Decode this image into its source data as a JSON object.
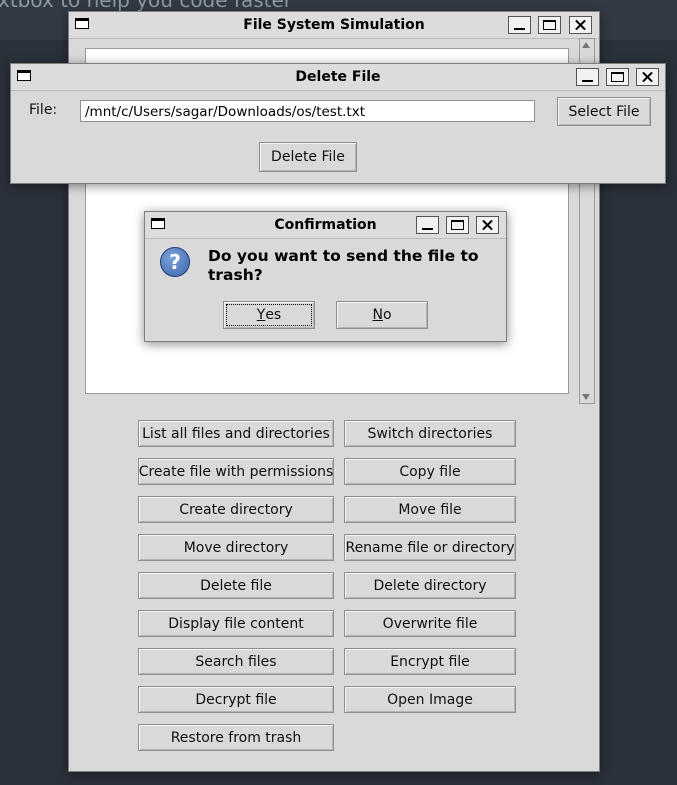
{
  "background": {
    "partial_text": "xtbox to help you code faster"
  },
  "main_window": {
    "title": "File System Simulation",
    "buttons": [
      {
        "label": "List all files and directories"
      },
      {
        "label": "Switch directories"
      },
      {
        "label": "Create file with permissions"
      },
      {
        "label": "Copy file"
      },
      {
        "label": "Create directory"
      },
      {
        "label": "Move file"
      },
      {
        "label": "Move directory"
      },
      {
        "label": "Rename file or directory"
      },
      {
        "label": "Delete file"
      },
      {
        "label": "Delete directory"
      },
      {
        "label": "Display file content"
      },
      {
        "label": "Overwrite file"
      },
      {
        "label": "Search files"
      },
      {
        "label": "Encrypt file"
      },
      {
        "label": "Decrypt file"
      },
      {
        "label": "Open Image"
      },
      {
        "label": "Restore from trash"
      }
    ]
  },
  "delete_window": {
    "title": "Delete File",
    "file_label": "File:",
    "file_value": "/mnt/c/Users/sagar/Downloads/os/test.txt",
    "select_button": "Select File",
    "delete_button": "Delete File"
  },
  "confirm_dialog": {
    "title": "Confirmation",
    "message": "Do you want to send the file to trash?",
    "yes_label": "Yes",
    "no_label": "No"
  },
  "icons": {
    "question": "question-icon",
    "window": "window-icon"
  }
}
